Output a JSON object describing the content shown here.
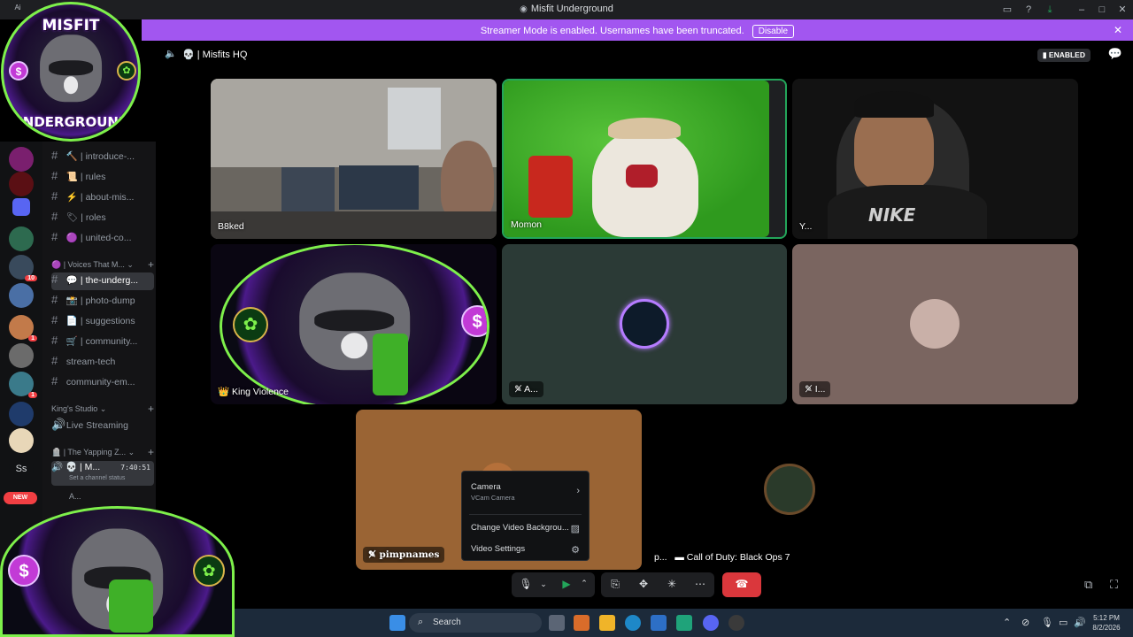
{
  "window": {
    "title": "Misfit Underground",
    "corner_label": "Ai"
  },
  "banner": {
    "message": "Streamer Mode is enabled. Usernames have been truncated.",
    "button": "Disable",
    "color": "#a256f0"
  },
  "overlay_logo": {
    "top_text": "MISFIT",
    "bottom_text": "UNDERGROUND"
  },
  "sidebar": {
    "channels": [
      {
        "emoji": "🔨",
        "label": "introduce-..."
      },
      {
        "emoji": "📜",
        "label": "rules"
      },
      {
        "emoji": "⚡",
        "label": "about-mis..."
      },
      {
        "emoji": "🏷",
        "label": "roles"
      },
      {
        "emoji": "🟣",
        "label": "united-co..."
      }
    ],
    "category_voices": "Voices That M...",
    "channels2": [
      {
        "emoji": "💬",
        "label": "the-underg..."
      },
      {
        "emoji": "📸",
        "label": "photo-dump"
      },
      {
        "emoji": "📄",
        "label": "suggestions"
      },
      {
        "emoji": "🛒",
        "label": "community..."
      },
      {
        "emoji": "",
        "label": "stream-tech"
      },
      {
        "emoji": "",
        "label": "community-em..."
      }
    ],
    "category_kings": "King's Studio",
    "voice_channel": "Live Streaming",
    "category_yapping": "The Yapping Z...",
    "current_voice": {
      "name": "M...",
      "timer": "7:40:51",
      "status": "Set a channel status"
    },
    "voice_user": "A...",
    "server_badges": [
      "10",
      "1",
      "1"
    ],
    "server_initials": "Ss",
    "new_badge": "NEW"
  },
  "call": {
    "channel_name": "| Misfits HQ",
    "enabled_label": "ENABLED",
    "tiles": [
      {
        "name": "B8ked"
      },
      {
        "name": "Momon"
      },
      {
        "name": "Y..."
      },
      {
        "name": "King Violence"
      },
      {
        "name": "A..."
      },
      {
        "name": "I..."
      },
      {
        "name": "pimpnames"
      },
      {
        "name": "p..."
      }
    ],
    "activity": "Call of Duty: Black Ops 7"
  },
  "context_menu": {
    "camera_label": "Camera",
    "camera_device": "VCam Camera",
    "background_label": "Change Video Backgrou...",
    "settings_label": "Video Settings"
  },
  "taskbar": {
    "search_placeholder": "Search",
    "time": "5:12 PM",
    "date": "8/2/2026"
  }
}
